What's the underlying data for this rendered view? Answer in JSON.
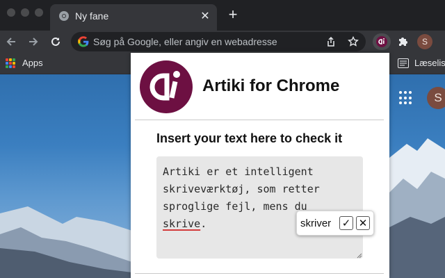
{
  "window": {
    "tab_title": "Ny fane",
    "close_glyph": "✕",
    "new_tab_glyph": "+"
  },
  "toolbar": {
    "omnibox_placeholder": "Søg på Google, eller angiv en webadresse",
    "profile_initial": "S",
    "icons": [
      "back-icon",
      "forward-icon",
      "reload-icon",
      "google-icon",
      "share-icon",
      "star-icon",
      "artiki-extension-icon",
      "extensions-puzzle-icon"
    ]
  },
  "bookmarks": {
    "apps_label": "Apps",
    "reading_list_label": "Læselis"
  },
  "new_tab_page": {
    "avatar_initial": "S"
  },
  "popup": {
    "title": "Artiki for Chrome",
    "instruction": "Insert your text here to check it",
    "text_before": "Artiki er et intelligent skriveværktøj, som retter sproglige fejl, mens du ",
    "text_flagged": "skrive",
    "text_after": "."
  },
  "suggestion": {
    "word": "skriver",
    "accept_glyph": "✓",
    "reject_glyph": "✕"
  },
  "colors": {
    "chrome_dark": "#202124",
    "toolbar": "#35363a",
    "artiki_brand": "#6d1042",
    "error_underline": "#d33a3a"
  }
}
